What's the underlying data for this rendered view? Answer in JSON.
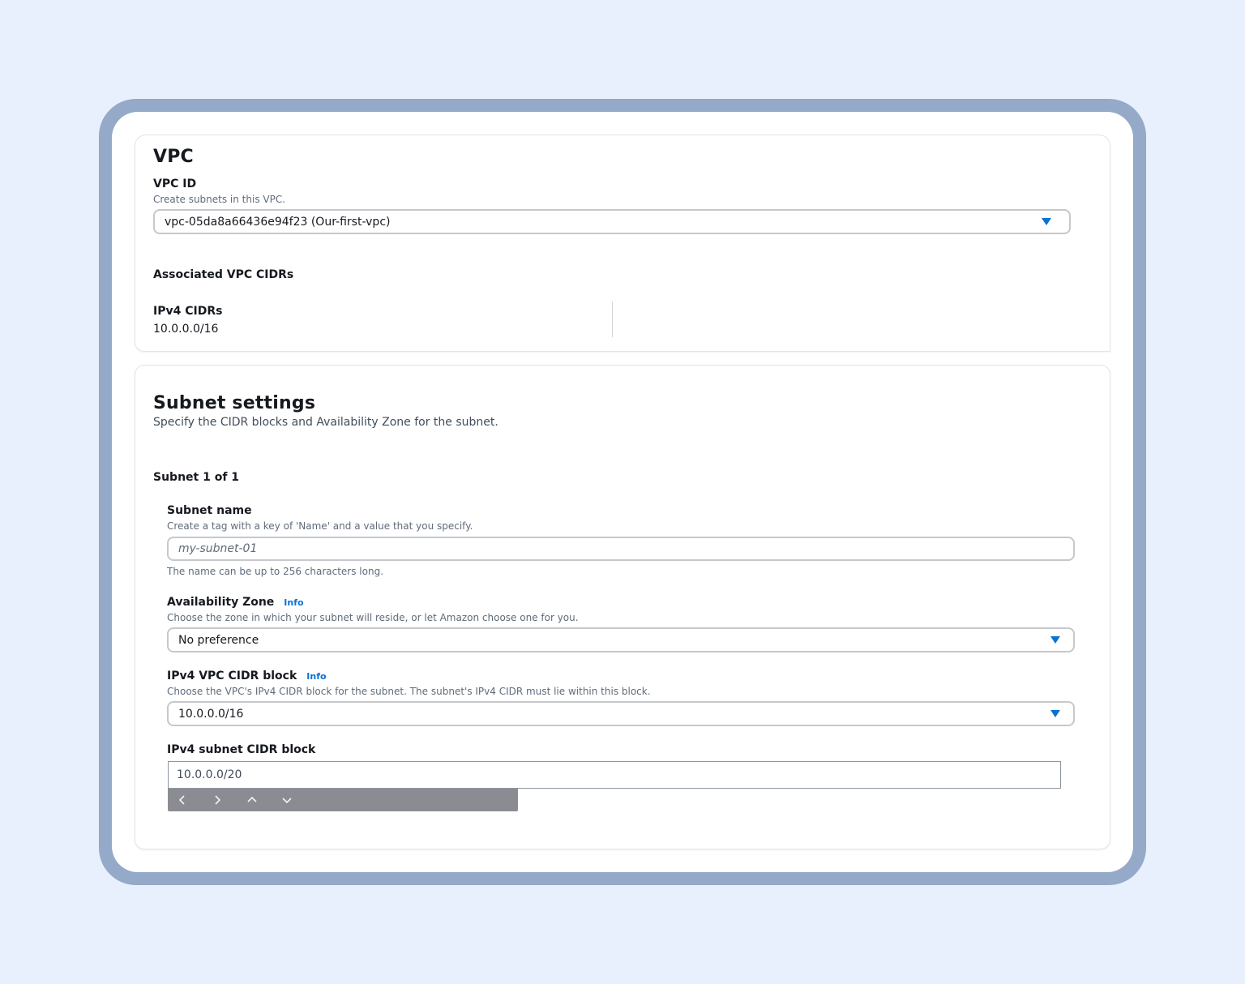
{
  "vpc": {
    "title": "VPC",
    "vpc_id_label": "VPC ID",
    "vpc_id_desc": "Create subnets in this VPC.",
    "vpc_id_value": "vpc-05da8a66436e94f23 (Our-first-vpc)",
    "associated_label": "Associated VPC CIDRs",
    "ipv4_cidrs_label": "IPv4 CIDRs",
    "ipv4_cidrs_value": "10.0.0.0/16"
  },
  "subnet": {
    "title": "Subnet settings",
    "desc": "Specify the CIDR blocks and Availability Zone for the subnet.",
    "count_label": "Subnet 1 of 1",
    "name_label": "Subnet name",
    "name_desc": "Create a tag with a key of 'Name' and a value that you specify.",
    "name_placeholder": "my-subnet-01",
    "name_hint": "The name can be up to 256 characters long.",
    "az_label": "Availability Zone",
    "az_info": "Info",
    "az_desc": "Choose the zone in which your subnet will reside, or let Amazon choose one for you.",
    "az_value": "No preference",
    "vpc_cidr_label": "IPv4 VPC CIDR block",
    "vpc_cidr_info": "Info",
    "vpc_cidr_desc": "Choose the VPC's IPv4 CIDR block for the subnet. The subnet's IPv4 CIDR must lie within this block.",
    "vpc_cidr_value": "10.0.0.0/16",
    "subnet_cidr_label": "IPv4 subnet CIDR block",
    "subnet_cidr_value": "10.0.0.0/20"
  },
  "icons": {
    "caret": "caret-down-icon",
    "nav_left": "chevron-left-icon",
    "nav_right": "chevron-right-icon",
    "nav_up": "chevron-up-icon",
    "nav_down": "chevron-down-icon"
  },
  "colors": {
    "accent": "#0972d3",
    "frame": "#95a9c8",
    "background": "#e8f0fd"
  }
}
